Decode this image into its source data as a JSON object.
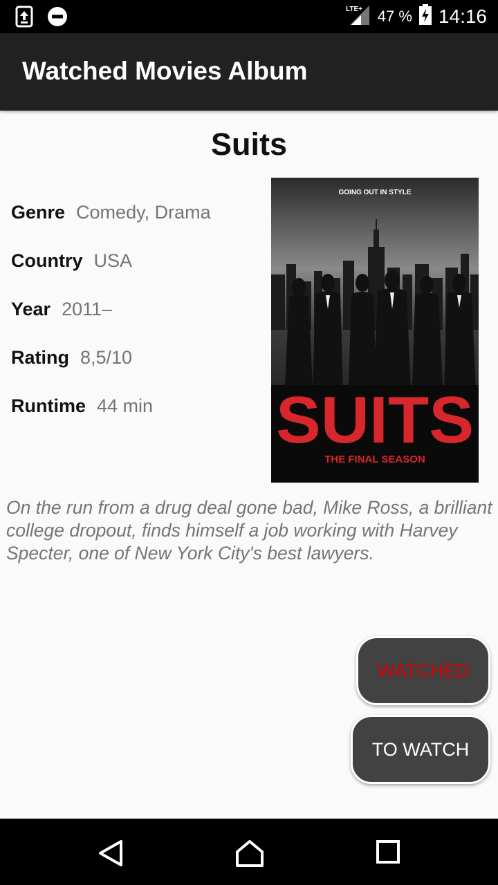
{
  "status_bar": {
    "network": "LTE+",
    "battery_percent": "47 %",
    "time": "14:16",
    "left_icons": [
      "upload-notification-icon",
      "do-not-disturb-icon"
    ]
  },
  "app_bar": {
    "title": "Watched Movies Album"
  },
  "movie": {
    "title": "Suits",
    "details": [
      {
        "label": "Genre",
        "value": "Comedy, Drama"
      },
      {
        "label": "Country",
        "value": "USA"
      },
      {
        "label": "Year",
        "value": "2011–"
      },
      {
        "label": "Rating",
        "value": "8,5/10"
      },
      {
        "label": "Runtime",
        "value": "44 min"
      }
    ],
    "poster": {
      "tagline": "GOING OUT IN STYLE",
      "logo": "SUITS",
      "subtitle": "THE FINAL SEASON"
    },
    "description": "On the run from a drug deal gone bad, Mike Ross, a brilliant college dropout, finds himself a job working with Harvey Specter, one of New York City's best lawyers."
  },
  "actions": {
    "watched_label": "WATCHED",
    "to_watch_label": "TO WATCH"
  },
  "colors": {
    "app_bar": "#212121",
    "button_bg": "#424242",
    "watched_text": "#d50000",
    "poster_red": "#d7262c"
  }
}
